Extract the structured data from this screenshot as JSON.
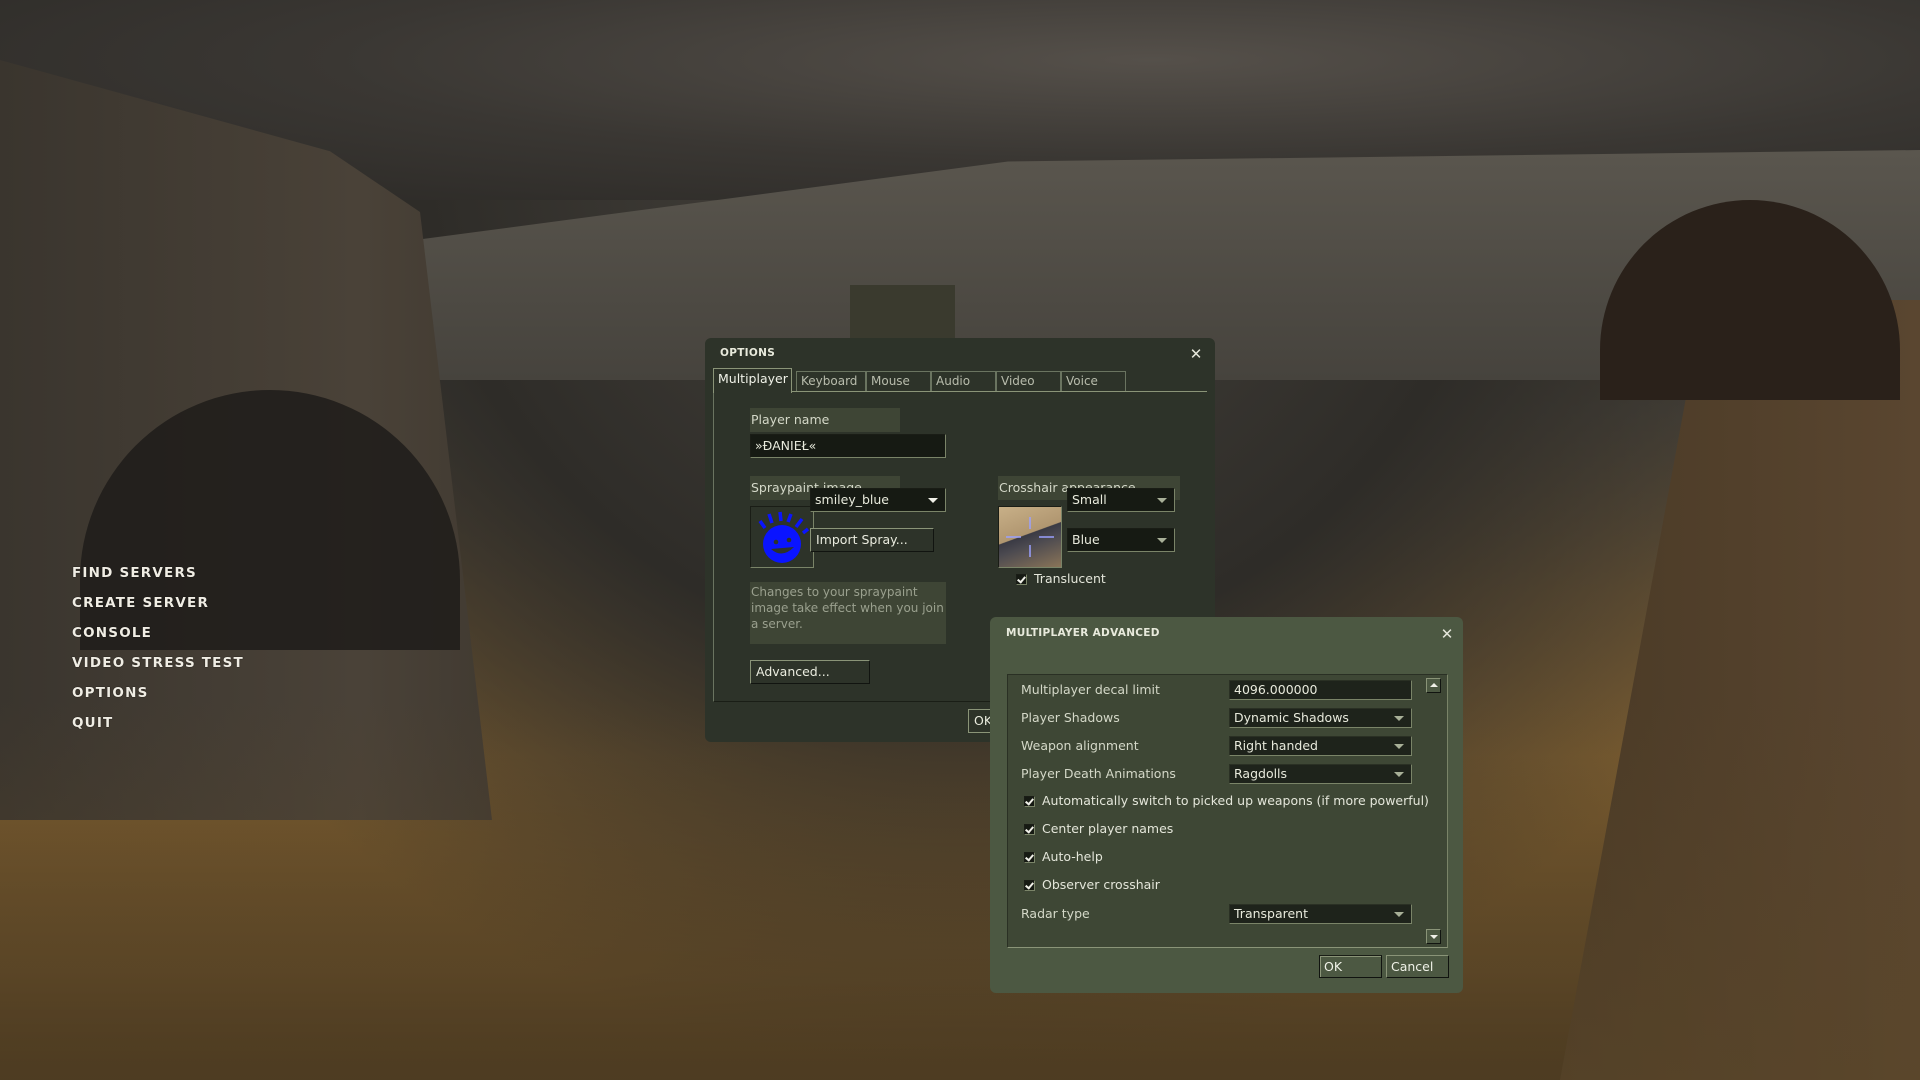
{
  "main_menu": {
    "items": [
      "FIND SERVERS",
      "CREATE SERVER",
      "CONSOLE",
      "VIDEO STRESS TEST",
      "OPTIONS",
      "QUIT"
    ]
  },
  "options_dialog": {
    "title": "OPTIONS",
    "close_icon": "close-icon",
    "tabs": [
      {
        "label": "Multiplayer",
        "active": true
      },
      {
        "label": "Keyboard",
        "active": false
      },
      {
        "label": "Mouse",
        "active": false
      },
      {
        "label": "Audio",
        "active": false
      },
      {
        "label": "Video",
        "active": false
      },
      {
        "label": "Voice",
        "active": false
      }
    ],
    "player_name_label": "Player name",
    "player_name_value": "»ĐANIEŁ«",
    "spray_label": "Spraypaint image",
    "spray_selected": "smiley_blue",
    "spray_color": "#0a14ff",
    "import_spray_label": "Import Spray...",
    "spray_hint": "Changes to your spraypaint image take effect when you join a server.",
    "advanced_label": "Advanced...",
    "crosshair_label": "Crosshair appearance",
    "crosshair_size": "Small",
    "crosshair_color": "Blue",
    "crosshair_translucent_label": "Translucent",
    "crosshair_translucent_checked": true,
    "ok_label": "OK"
  },
  "advanced_dialog": {
    "title": "MULTIPLAYER ADVANCED",
    "close_icon": "close-icon",
    "rows": {
      "decal_limit_label": "Multiplayer decal limit",
      "decal_limit_value": "4096.000000",
      "player_shadows_label": "Player Shadows",
      "player_shadows_value": "Dynamic Shadows",
      "weapon_alignment_label": "Weapon alignment",
      "weapon_alignment_value": "Right handed",
      "death_anim_label": "Player Death Animations",
      "death_anim_value": "Ragdolls",
      "radar_type_label": "Radar type",
      "radar_type_value": "Transparent"
    },
    "checkboxes": [
      {
        "label": "Automatically switch to picked up weapons (if more powerful)",
        "checked": true
      },
      {
        "label": "Center player names",
        "checked": true
      },
      {
        "label": "Auto-help",
        "checked": true
      },
      {
        "label": "Observer crosshair",
        "checked": true
      }
    ],
    "ok_label": "OK",
    "cancel_label": "Cancel"
  }
}
